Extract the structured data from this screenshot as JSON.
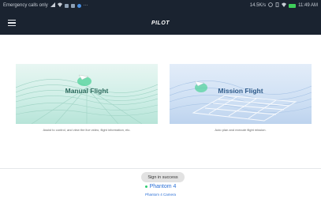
{
  "status_bar": {
    "left_text": "Emergency calls only",
    "right_text": "14.5K/s",
    "time": "11:49 AM",
    "icons": [
      "signal-icon",
      "wifi-icon",
      "notification-icon",
      "notification-icon",
      "notification-icon",
      "more-icon"
    ],
    "right_icons": [
      "alarm-icon",
      "vibrate-icon",
      "wifi-icon",
      "battery-icon"
    ]
  },
  "app_bar": {
    "title": "PILOT",
    "menu_icon": "hamburger-menu-icon"
  },
  "cards": [
    {
      "title": "Manual Flight",
      "description": "Assist to control, and view the live video, flight information, etc."
    },
    {
      "title": "Mission Flight",
      "description": "Auto plan and execute flight mission."
    }
  ],
  "toast": "Sign in success",
  "device": {
    "name": "Phantom 4",
    "camera": "Phantom 4 Camera"
  },
  "colors": {
    "app_bar": "#1a2330",
    "device_link": "#2a6fd6",
    "online_dot": "#2ecc71"
  }
}
